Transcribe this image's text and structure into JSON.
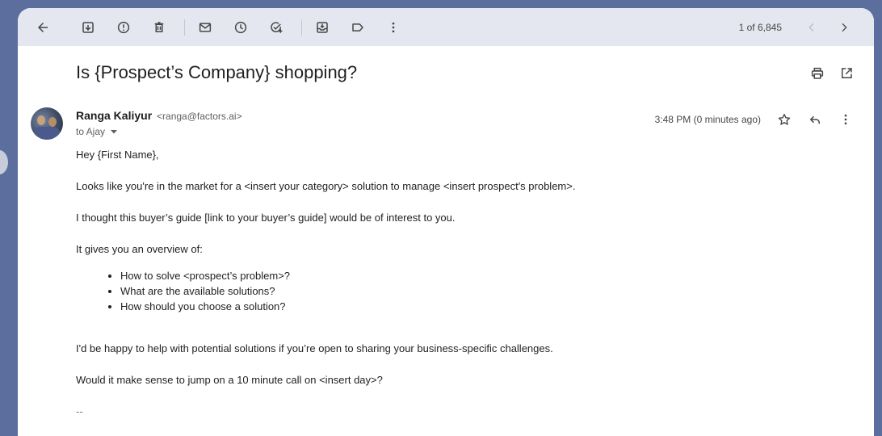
{
  "toolbar": {
    "icons": [
      "back-arrow-icon",
      "archive-icon",
      "report-spam-icon",
      "delete-icon",
      "mark-unread-icon",
      "snooze-icon",
      "add-task-icon",
      "move-to-icon",
      "label-icon",
      "more-vert-icon"
    ],
    "pager_text": "1 of 6,845"
  },
  "message": {
    "subject": "Is {Prospect’s Company} shopping?",
    "sender_name": "Ranga Kaliyur",
    "sender_email": "<ranga@factors.ai>",
    "to": "to Ajay",
    "time": "3:48 PM (0 minutes ago)"
  },
  "body": {
    "greeting": "Hey {First Name},",
    "p1": "Looks like you're in the market for a <insert your category> solution to manage <insert prospect's problem>.",
    "p2": "I thought this buyer’s guide [link to your buyer’s guide] would be of interest to you.",
    "p3": "It gives you an overview of:",
    "bullets": [
      "How to solve <prospect’s problem>?",
      "What are the available solutions?",
      "How should you choose a solution?"
    ],
    "p4": "I'd be happy to help with potential solutions if you’re open to sharing your business-specific challenges.",
    "p5": "Would it make sense to jump on a 10 minute call on <insert day>?",
    "signature": "--"
  }
}
